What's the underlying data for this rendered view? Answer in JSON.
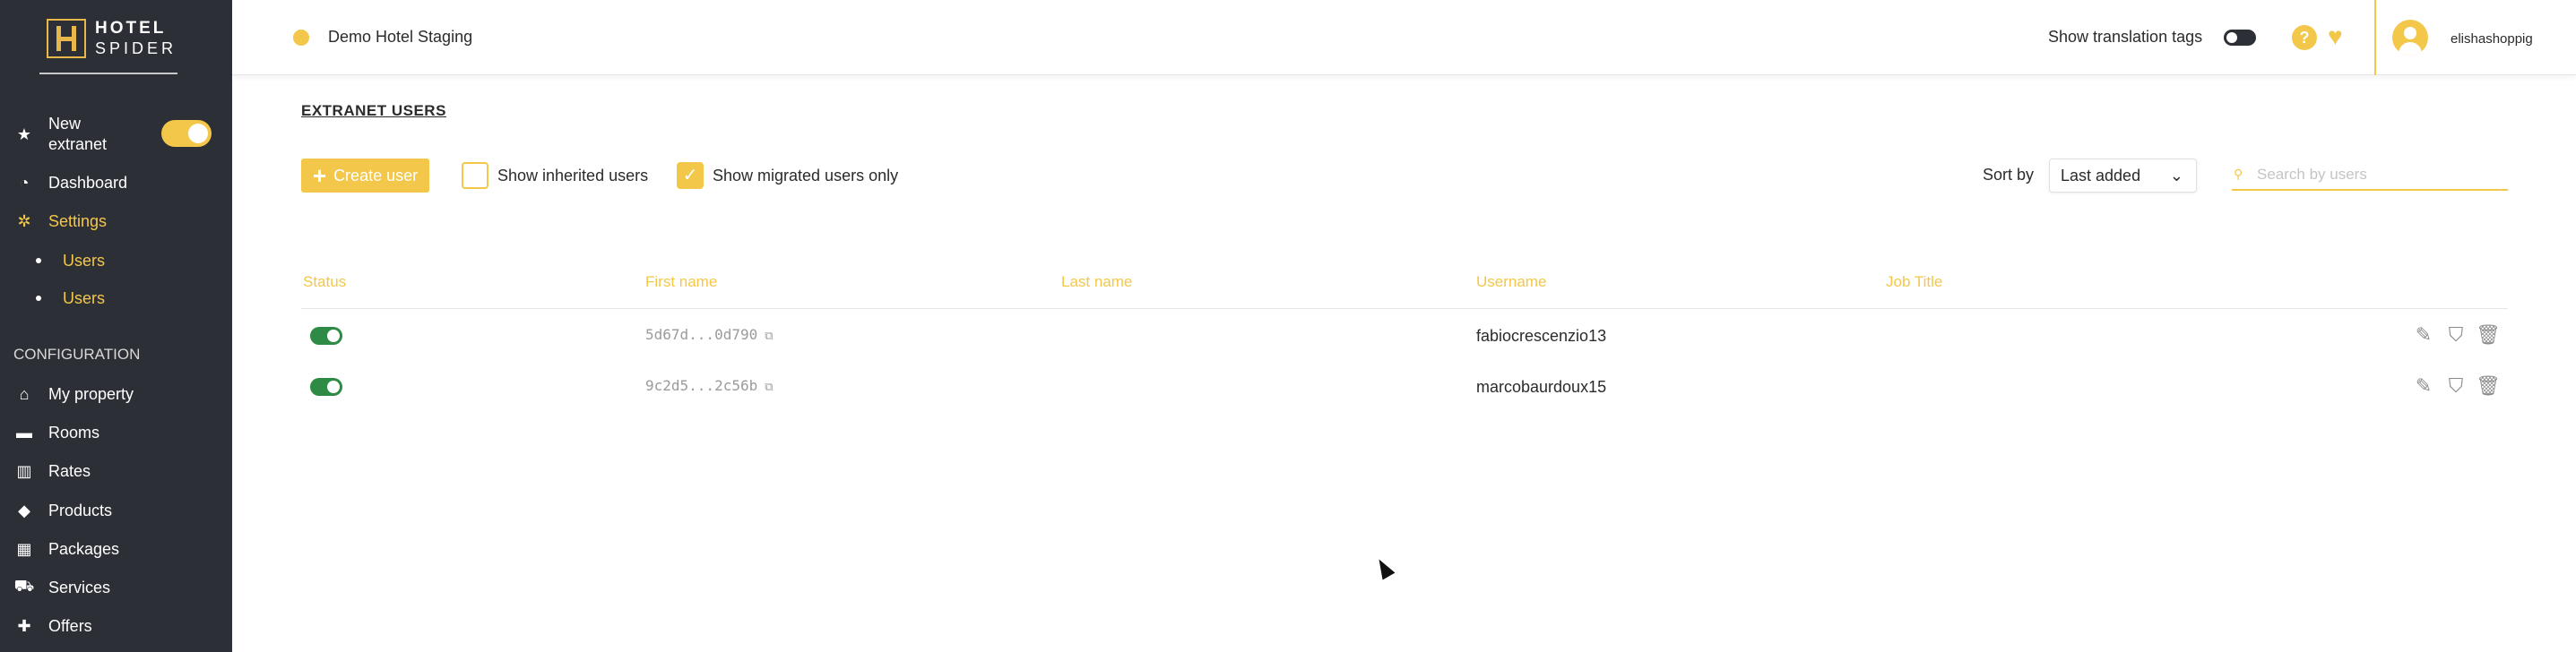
{
  "brand": {
    "line1": "HOTEL",
    "line2": "SPIDER"
  },
  "sidebar": {
    "new_extranet_label_1": "New",
    "new_extranet_label_2": "extranet",
    "new_extranet_on": true,
    "items": [
      {
        "label": "Dashboard",
        "icon": "dashboard-icon"
      },
      {
        "label": "Settings",
        "icon": "gear-icon",
        "active": true
      }
    ],
    "sub_items": [
      {
        "label": "Users"
      },
      {
        "label": "Users"
      }
    ],
    "section_title": "CONFIGURATION",
    "config_items": [
      {
        "label": "My property",
        "icon": "home-icon"
      },
      {
        "label": "Rooms",
        "icon": "bed-icon"
      },
      {
        "label": "Rates",
        "icon": "columns-icon"
      },
      {
        "label": "Products",
        "icon": "tags-icon"
      },
      {
        "label": "Packages",
        "icon": "boxes-icon"
      },
      {
        "label": "Services",
        "icon": "cart-icon"
      },
      {
        "label": "Offers",
        "icon": "gift-icon"
      }
    ]
  },
  "topbar": {
    "hotel_name": "Demo Hotel Staging",
    "translation_tags_label": "Show translation tags",
    "translation_tags_on": false,
    "help_glyph": "?",
    "username": "elishashoppig"
  },
  "main": {
    "title": "EXTRANET USERS",
    "create_user_label": "Create user",
    "show_inherited_label": "Show inherited users",
    "show_inherited_checked": false,
    "show_migrated_label": "Show migrated users only",
    "show_migrated_checked": true,
    "sort_label": "Sort by",
    "sort_value": "Last added",
    "search_placeholder": "Search by users"
  },
  "table": {
    "columns": [
      "Status",
      "First name",
      "Last name",
      "Username",
      "Job Title"
    ],
    "rows": [
      {
        "status_on": true,
        "first_name": "5d67d...0d790",
        "last_name": "",
        "username": "fabiocrescenzio13",
        "job_title": ""
      },
      {
        "status_on": true,
        "first_name": "9c2d5...2c56b",
        "last_name": "",
        "username": "marcobaurdoux15",
        "job_title": ""
      }
    ]
  },
  "colors": {
    "accent": "#f3c74a",
    "sidebar_bg": "#2d2f36",
    "toggle_on": "#2e8b45"
  }
}
